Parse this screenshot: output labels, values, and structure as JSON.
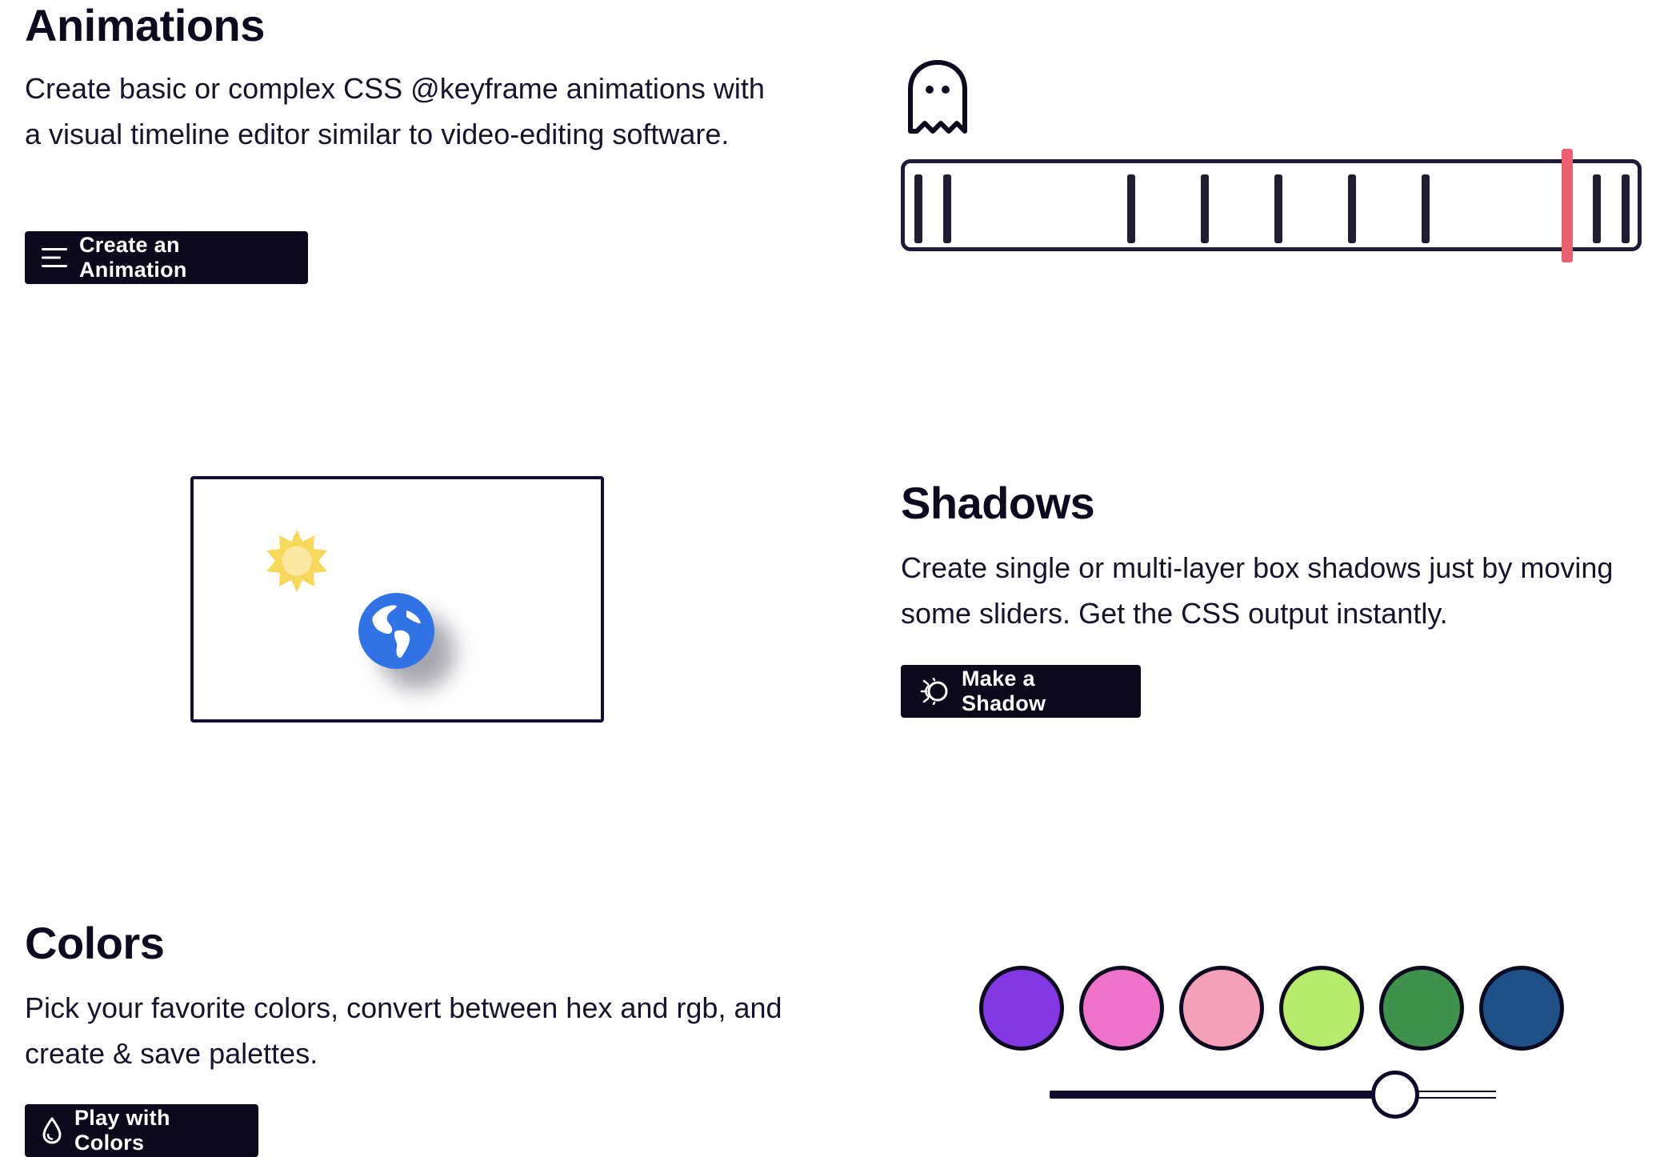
{
  "animations": {
    "title": "Animations",
    "description": "Create basic or complex CSS @keyframe animations with a visual timeline editor similar to video-editing software.",
    "button_label": "Create an Animation",
    "button_icon": "menu-lines-icon",
    "preview_icon": "ghost-icon",
    "timeline": {
      "keyframe_count": 9,
      "playhead_color": "#e9606f"
    }
  },
  "shadows": {
    "title": "Shadows",
    "description": "Create single or multi-layer box shadows just by moving some sliders. Get the CSS output instantly.",
    "button_label": "Make a Shadow",
    "button_icon": "sun-shadow-icon",
    "preview": {
      "light_icon": "sun-icon",
      "object_icon": "globe-icon",
      "sun_color": "#f7d85b",
      "globe_color": "#2f73e6"
    }
  },
  "colors": {
    "title": "Colors",
    "description": "Pick your favorite colors, convert between hex and rgb, and create & save palettes.",
    "button_label": "Play with Colors",
    "button_icon": "droplet-icon",
    "palette": [
      "#8338e3",
      "#ee72c9",
      "#f3a0b8",
      "#b6ea6a",
      "#3f924b",
      "#1f5189"
    ],
    "slider_value_percent": 70
  }
}
